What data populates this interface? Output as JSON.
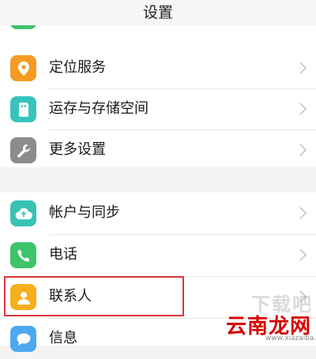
{
  "header": {
    "title": "设置"
  },
  "group1": {
    "items": [
      {
        "label": "定位服务",
        "icon": "location-icon",
        "color": "#f59b23"
      },
      {
        "label": "运存与存储空间",
        "icon": "storage-icon",
        "color": "#38c4bd"
      },
      {
        "label": "更多设置",
        "icon": "wrench-icon",
        "color": "#8c8c8c"
      }
    ]
  },
  "group2": {
    "items": [
      {
        "label": "帐户与同步",
        "icon": "cloud-sync-icon",
        "color": "#39c3b3"
      },
      {
        "label": "电话",
        "icon": "phone-icon",
        "color": "#3ec46a"
      },
      {
        "label": "联系人",
        "icon": "contact-icon",
        "color": "#f6b01c",
        "highlighted": true
      },
      {
        "label": "信息",
        "icon": "message-icon",
        "color": "#4ca9ef"
      }
    ]
  },
  "watermark": {
    "site": "云南龙网",
    "big": "下载吧",
    "url": "www.xiazaiba.com"
  }
}
